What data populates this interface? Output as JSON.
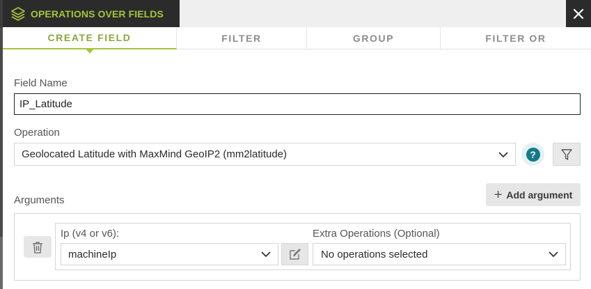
{
  "dialog": {
    "title": "OPERATIONS OVER FIELDS",
    "title_icon": "layers-icon",
    "close_icon": "close-icon",
    "accent_color": "#a4c639"
  },
  "tabs": [
    {
      "label": "CREATE FIELD",
      "active": true
    },
    {
      "label": "FILTER",
      "active": false
    },
    {
      "label": "GROUP",
      "active": false
    },
    {
      "label": "FILTER OR",
      "active": false
    }
  ],
  "form": {
    "field_name_label": "Field Name",
    "field_name_value": "IP_Latitude",
    "operation_label": "Operation",
    "operation_value": "Geolocated Latitude with MaxMind GeoIP2 (mm2latitude)",
    "help_text": "?",
    "help_icon": "help-icon",
    "filter_icon": "filter-icon"
  },
  "arguments": {
    "label": "Arguments",
    "add_button_label": "Add argument",
    "items": [
      {
        "ip_label": "Ip (v4 or v6):",
        "ip_value": "machineIp",
        "extra_label": "Extra Operations (Optional)",
        "extra_value": "No operations selected"
      }
    ]
  }
}
